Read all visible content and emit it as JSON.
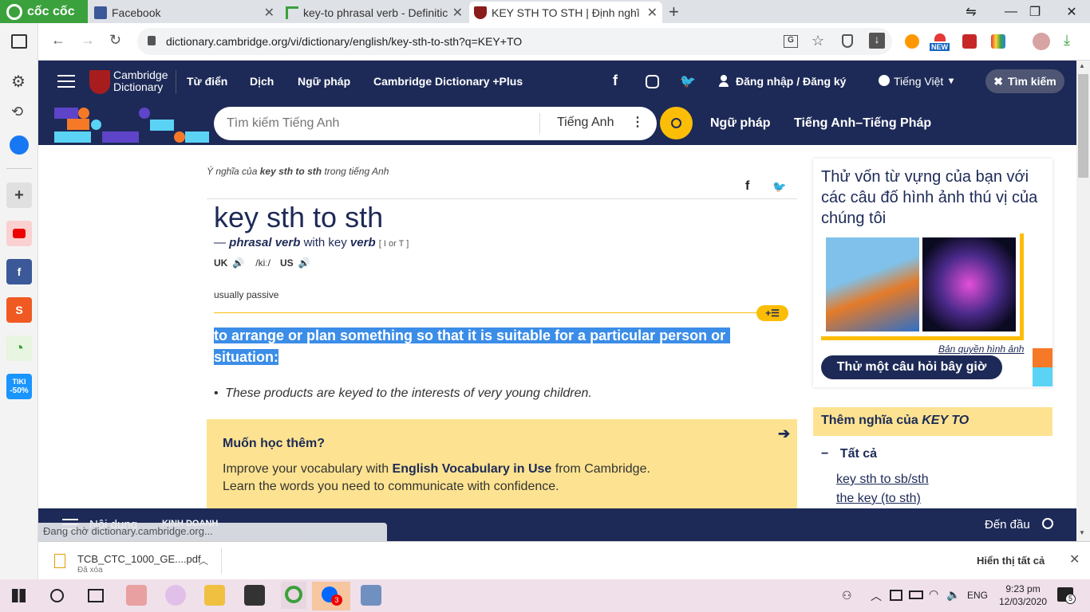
{
  "browser": {
    "brand": "cốc cốc",
    "tabs": [
      {
        "title": "Facebook"
      },
      {
        "title": "key-to phrasal verb - Definitic"
      },
      {
        "title": "KEY STH TO STH | Định nghĩa"
      }
    ],
    "url": "dictionary.cambridge.org/vi/dictionary/english/key-sth-to-sth?q=KEY+TO",
    "new_badge": "NEW"
  },
  "site_nav": {
    "logo_line1": "Cambridge",
    "logo_line2": "Dictionary",
    "items": [
      "Từ điển",
      "Dịch",
      "Ngữ pháp",
      "Cambridge Dictionary +Plus"
    ],
    "login": "Đăng nhập / Đăng ký",
    "language": "Tiếng Việt",
    "search_button": "Tìm kiếm"
  },
  "search": {
    "placeholder": "Tìm kiếm Tiếng Anh",
    "dataset": "Tiếng Anh",
    "links": [
      "Ngữ pháp",
      "Tiếng Anh–Tiếng Pháp"
    ]
  },
  "entry": {
    "breadcrumb_prefix": "Ý nghĩa của",
    "breadcrumb_term": "key sth to sth",
    "breadcrumb_suffix": "trong tiếng Anh",
    "headword": "key sth to sth",
    "dash": "—",
    "pos": "phrasal verb",
    "with_text": "with key",
    "verb": "verb",
    "grammar": "[ I or T ]",
    "uk": "UK",
    "ipa": "/kiː/",
    "us": "US",
    "usage": "usually passive",
    "definition_line1": "to arrange or plan something so that it is suitable for a particular person or",
    "definition_line2": "situation:",
    "example": "These products are keyed to the interests of very young children.",
    "bullet": "•"
  },
  "promo": {
    "title": "Muốn học thêm?",
    "line1_prefix": "Improve your vocabulary with",
    "line1_bold": "English Vocabulary in Use",
    "line1_suffix": "from Cambridge.",
    "line2": "Learn the words you need to communicate with confidence."
  },
  "quiz": {
    "title": "Thử vốn từ vựng của bạn với các câu đố hình ảnh thú vị của chúng tôi",
    "copyright": "Bản quyền hình ảnh",
    "button": "Thử một câu hỏi bây giờ"
  },
  "more": {
    "header_prefix": "Thêm nghĩa của",
    "header_term": "KEY TO",
    "all": "Tất cả",
    "links": [
      "key sth to sb/sth",
      "the key (to sth)"
    ]
  },
  "bottom": {
    "menu": "Nội dung",
    "tag": "KINH DOANH",
    "top": "Đến đầu",
    "status": "Đang chờ dictionary.cambridge.org..."
  },
  "download": {
    "filename": "TCB_CTC_1000_GE....pdf",
    "status": "Đã xóa",
    "show_all": "Hiển thị tất cả"
  },
  "taskbar": {
    "lang": "ENG",
    "time": "9:23 pm",
    "date": "12/03/2020",
    "badge": "3",
    "notif": "5"
  },
  "sidebar": {
    "tiki_label": "TIKI",
    "tiki_discount": "-50%"
  }
}
